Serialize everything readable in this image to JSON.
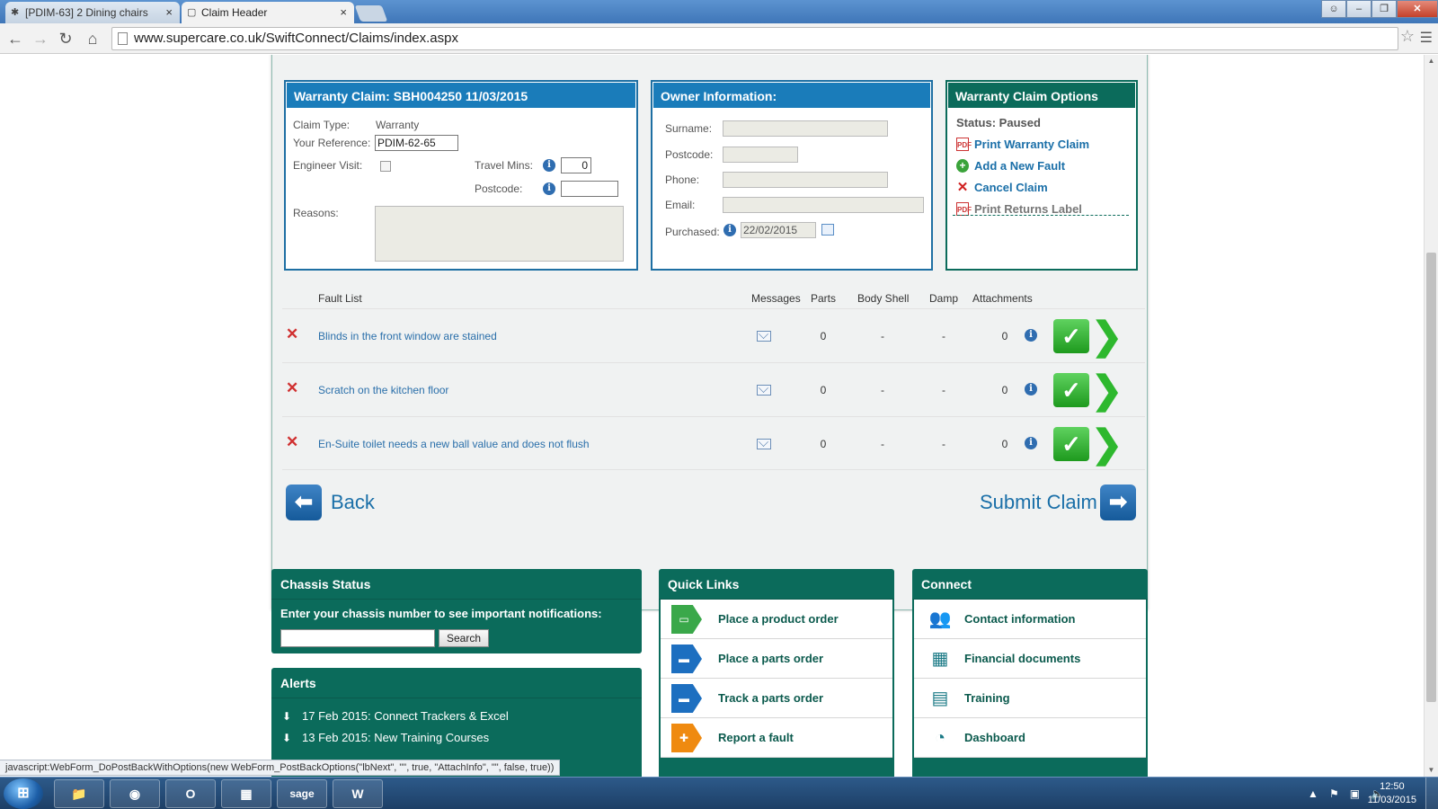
{
  "browser": {
    "tabs": [
      {
        "label": "[PDIM-63] 2 Dining chairs",
        "active": false
      },
      {
        "label": "Claim Header",
        "active": true
      }
    ],
    "url": "www.supercare.co.uk/SwiftConnect/Claims/index.aspx",
    "status_text": "javascript:WebForm_DoPostBackWithOptions(new WebForm_PostBackOptions(\"lbNext\", \"\", true, \"AttachInfo\", \"\", false, true))"
  },
  "claim": {
    "title": "Warranty Claim: SBH004250 11/03/2015",
    "claim_type_label": "Claim Type:",
    "claim_type_value": "Warranty",
    "your_reference_label": "Your Reference:",
    "your_reference_value": "PDIM-62-65",
    "engineer_visit_label": "Engineer Visit:",
    "travel_mins_label": "Travel Mins:",
    "travel_mins_value": "0",
    "postcode_label": "Postcode:",
    "postcode_value": "",
    "reasons_label": "Reasons:"
  },
  "owner": {
    "title": "Owner Information:",
    "surname_label": "Surname:",
    "postcode_label": "Postcode:",
    "phone_label": "Phone:",
    "email_label": "Email:",
    "purchased_label": "Purchased:",
    "purchased_value": "22/02/2015"
  },
  "options": {
    "title": "Warranty Claim Options",
    "status": "Status: Paused",
    "items": [
      {
        "label": "Print Warranty Claim",
        "icon": "pdf-icon"
      },
      {
        "label": "Add a New Fault",
        "icon": "add-icon"
      },
      {
        "label": "Cancel Claim",
        "icon": "cancel-icon"
      },
      {
        "label": "Print Returns Label",
        "icon": "pdf-icon"
      }
    ]
  },
  "faults": {
    "headers": {
      "fault_list": "Fault List",
      "messages": "Messages",
      "parts": "Parts",
      "body_shell": "Body Shell",
      "damp": "Damp",
      "attachments": "Attachments"
    },
    "rows": [
      {
        "description": "Blinds in the front window are stained",
        "parts": "0",
        "body_shell": "-",
        "damp": "-",
        "attachments": "0"
      },
      {
        "description": "Scratch on the kitchen floor",
        "parts": "0",
        "body_shell": "-",
        "damp": "-",
        "attachments": "0"
      },
      {
        "description": "En-Suite toilet needs a new ball value and does not flush",
        "parts": "0",
        "body_shell": "-",
        "damp": "-",
        "attachments": "0"
      }
    ]
  },
  "actions": {
    "back_label": "Back",
    "submit_label": "Submit Claim"
  },
  "chassis": {
    "title": "Chassis Status",
    "prompt": "Enter your chassis number to see important notifications:",
    "search_label": "Search"
  },
  "alerts": {
    "title": "Alerts",
    "items": [
      "17 Feb 2015: Connect Trackers & Excel",
      "13 Feb 2015: New Training Courses"
    ]
  },
  "quick_links": {
    "title": "Quick Links",
    "items": [
      {
        "label": "Place a product order",
        "icon": "caravan-icon"
      },
      {
        "label": "Place a parts order",
        "icon": "truck-icon"
      },
      {
        "label": "Track a parts order",
        "icon": "truck-icon"
      },
      {
        "label": "Report a fault",
        "icon": "tools-icon"
      }
    ]
  },
  "connect": {
    "title": "Connect",
    "items": [
      {
        "label": "Contact information",
        "icon": "people-icon"
      },
      {
        "label": "Financial documents",
        "icon": "calculator-icon"
      },
      {
        "label": "Training",
        "icon": "calendar-icon"
      },
      {
        "label": "Dashboard",
        "icon": "gauge-icon"
      }
    ]
  },
  "taskbar": {
    "apps": [
      "explorer-icon",
      "chrome-icon",
      "outlook-icon",
      "calculator-icon",
      "sage-icon",
      "word-icon"
    ],
    "sage_label": "sage",
    "word_label": "W",
    "time": "12:50",
    "date": "11/03/2015"
  },
  "colors": {
    "teal": "#0b6b5b",
    "blue": "#1a7cba",
    "link": "#1a6fa8"
  }
}
